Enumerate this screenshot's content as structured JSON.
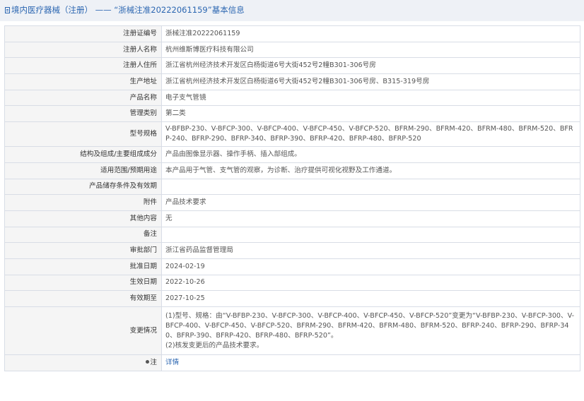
{
  "header": {
    "title": "境内医疗器械（注册） —— “浙械注准20222061159”基本信息",
    "icon": "document-icon"
  },
  "rows": [
    {
      "label": "注册证编号",
      "value": "浙械注准20222061159"
    },
    {
      "label": "注册人名称",
      "value": "杭州维斯博医疗科技有限公司"
    },
    {
      "label": "注册人住所",
      "value": "浙江省杭州经济技术开发区白杨街道6号大街452号2幢B301-306号房"
    },
    {
      "label": "生产地址",
      "value": "浙江省杭州经济技术开发区白杨街道6号大街452号2幢B301-306号房、B315-319号房"
    },
    {
      "label": "产品名称",
      "value": "电子支气管镜"
    },
    {
      "label": "管理类别",
      "value": "第二类"
    },
    {
      "label": "型号规格",
      "value": "V-BFBP-230、V-BFCP-300、V-BFCP-400、V-BFCP-450、V-BFCP-520、BFRM-290、BFRM-420、BFRM-480、BFRM-520、BFRP-240、BFRP-290、BFRP-340、BFRP-390、BFRP-420、BFRP-480、BFRP-520"
    },
    {
      "label": "结构及组成/主要组成成分",
      "value": "产品由图像显示器、操作手柄、插入部组成。"
    },
    {
      "label": "适用范围/预期用途",
      "value": "本产品用于气管、支气管的观察，为诊断、治疗提供可视化视野及工作通道。"
    },
    {
      "label": "产品储存条件及有效期",
      "value": ""
    },
    {
      "label": "附件",
      "value": "产品技术要求"
    },
    {
      "label": "其他内容",
      "value": "无"
    },
    {
      "label": "备注",
      "value": ""
    },
    {
      "label": "审批部门",
      "value": "浙江省药品监督管理局"
    },
    {
      "label": "批准日期",
      "value": "2024-02-19"
    },
    {
      "label": "生效日期",
      "value": "2022-10-26"
    },
    {
      "label": "有效期至",
      "value": "2027-10-25"
    }
  ],
  "change": {
    "label": "变更情况",
    "line1": "(1)型号、规格：由“V-BFBP-230、V-BFCP-300、V-BFCP-400、V-BFCP-450、V-BFCP-520”变更为“V-BFBP-230、V-BFCP-300、V-BFCP-400、V-BFCP-450、V-BFCP-520、BFRM-290、BFRM-420、BFRM-480、BFRM-520、BFRP-240、BFRP-290、BFRP-340、BFRP-390、BFRP-420、BFRP-480、BFRP-520”。",
    "line2": "(2)核发变更后的产品技术要求。"
  },
  "note": {
    "label": "注",
    "icon": "pin-icon",
    "link": "详情"
  }
}
